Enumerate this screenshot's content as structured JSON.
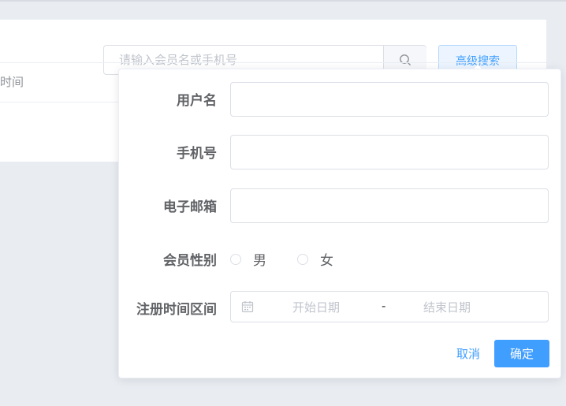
{
  "toolbar": {
    "search_placeholder": "请输入会员名或手机号",
    "search_value": "",
    "advanced_search_label": "高级搜索"
  },
  "table": {
    "header_partial": "时间"
  },
  "advanced_form": {
    "username_label": "用户名",
    "username_value": "",
    "phone_label": "手机号",
    "phone_value": "",
    "email_label": "电子邮箱",
    "email_value": "",
    "gender_label": "会员性别",
    "gender_options": [
      "男",
      "女"
    ],
    "gender_selected": null,
    "register_range_label": "注册时间区间",
    "start_date_placeholder": "开始日期",
    "range_separator": "-",
    "end_date_placeholder": "结束日期",
    "cancel_label": "取消",
    "confirm_label": "确定"
  },
  "colors": {
    "primary": "#409eff",
    "background": "#e9edf2",
    "border": "#dcdfe6",
    "placeholder": "#c0c4cc",
    "text": "#606266"
  },
  "icons": {
    "search": "search-icon",
    "calendar": "calendar-icon"
  }
}
